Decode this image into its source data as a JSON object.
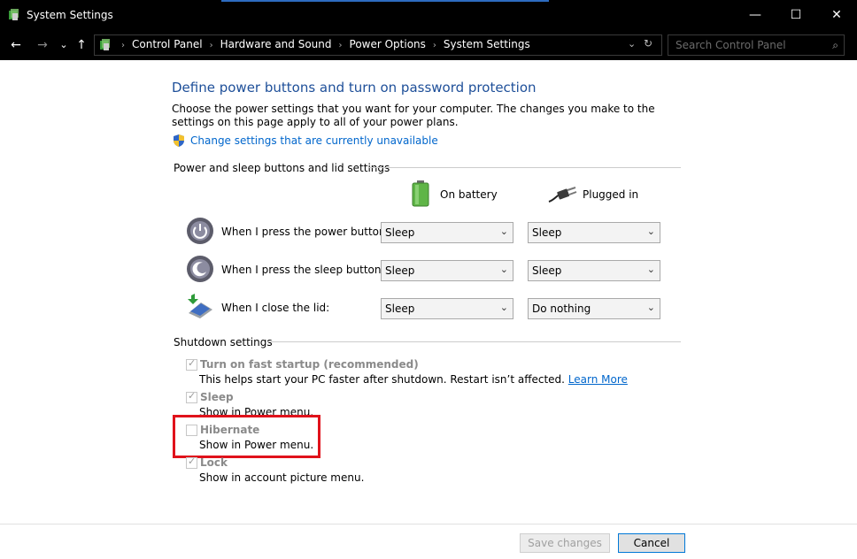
{
  "window": {
    "title": "System Settings",
    "minimize": "—",
    "maximize": "☐",
    "close": "✕"
  },
  "nav": {
    "back": "←",
    "forward": "→",
    "recent": "⌄",
    "up": "↑",
    "breadcrumbs": [
      "Control Panel",
      "Hardware and Sound",
      "Power Options",
      "System Settings"
    ],
    "separator": "›",
    "dropdown": "⌄",
    "refresh": "↻",
    "search_placeholder": "Search Control Panel",
    "search_glyph": "⌕"
  },
  "page": {
    "heading": "Define power buttons and turn on password protection",
    "description": "Choose the power settings that you want for your computer. The changes you make to the settings on this page apply to all of your power plans.",
    "change_link": "Change settings that are currently unavailable"
  },
  "buttons_section": {
    "title": "Power and sleep buttons and lid settings",
    "col_battery": "On battery",
    "col_plugged": "Plugged in",
    "rows": [
      {
        "label": "When I press the power button:",
        "icon": "power-button-icon",
        "battery": "Sleep",
        "plugged": "Sleep"
      },
      {
        "label": "When I press the sleep button:",
        "icon": "sleep-button-icon",
        "battery": "Sleep",
        "plugged": "Sleep"
      },
      {
        "label": "When I close the lid:",
        "icon": "laptop-lid-icon",
        "battery": "Sleep",
        "plugged": "Do nothing"
      }
    ]
  },
  "shutdown_section": {
    "title": "Shutdown settings",
    "items": [
      {
        "label": "Turn on fast startup (recommended)",
        "desc": "This helps start your PC faster after shutdown. Restart isn’t affected.",
        "link": "Learn More",
        "checked": true
      },
      {
        "label": "Sleep",
        "desc": "Show in Power menu.",
        "checked": true
      },
      {
        "label": "Hibernate",
        "desc": "Show in Power menu.",
        "checked": false
      },
      {
        "label": "Lock",
        "desc": "Show in account picture menu.",
        "checked": true
      }
    ]
  },
  "footer": {
    "save": "Save changes",
    "cancel": "Cancel"
  },
  "colors": {
    "heading": "#1e4f99",
    "link": "#0066cc",
    "highlight": "#e0121b"
  }
}
